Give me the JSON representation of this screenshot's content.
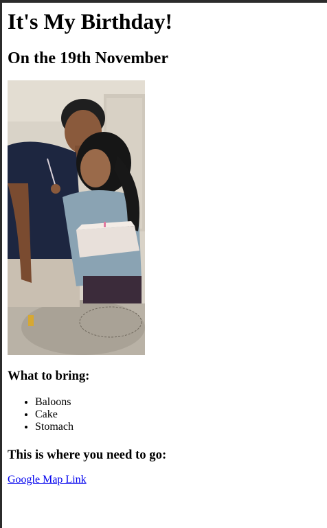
{
  "page": {
    "title": "It's My Birthday!",
    "subtitle": "On the 19th November",
    "bring_heading": "What to bring:",
    "bring_items": [
      "Baloons",
      "Cake",
      "Stomach"
    ],
    "directions_heading": "This is where you need to go:",
    "map_link_text": "Google Map Link"
  },
  "colors": {
    "link": "#0000ee",
    "text": "#000000",
    "background": "#ffffff"
  }
}
